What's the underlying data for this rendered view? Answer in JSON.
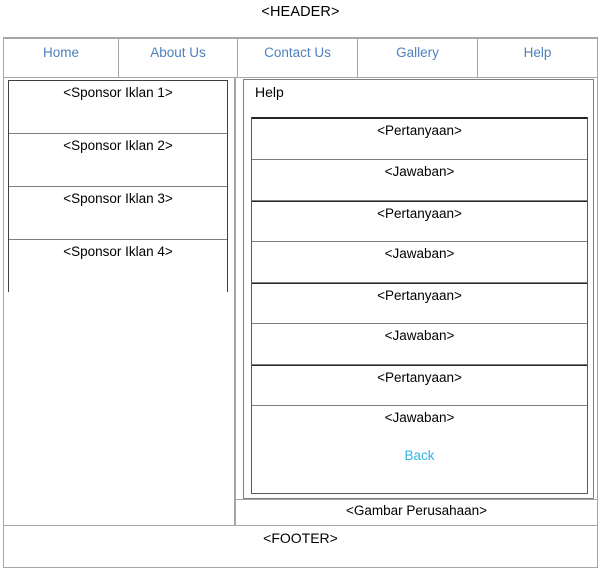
{
  "page": {
    "header_label": "<HEADER>",
    "footer_label": "<FOOTER>",
    "company_image_label": "<Gambar Perusahaan>"
  },
  "nav": {
    "link_color": "#4f81bd",
    "items": [
      {
        "label": "Home"
      },
      {
        "label": "About Us"
      },
      {
        "label": "Contact Us"
      },
      {
        "label": "Gallery"
      },
      {
        "label": "Help"
      }
    ]
  },
  "sidebar": {
    "sponsors": [
      {
        "label": "<Sponsor Iklan 1>"
      },
      {
        "label": "<Sponsor Iklan 2>"
      },
      {
        "label": "<Sponsor Iklan 3>"
      },
      {
        "label": "<Sponsor Iklan 4>"
      }
    ]
  },
  "main": {
    "panel_title": "Help",
    "back_label": "Back",
    "back_color": "#2fb6e8",
    "faq_rows": [
      {
        "label": "<Pertanyaan>",
        "kind": "question"
      },
      {
        "label": "<Jawaban>",
        "kind": "answer"
      },
      {
        "label": "<Pertanyaan>",
        "kind": "question"
      },
      {
        "label": "<Jawaban>",
        "kind": "answer"
      },
      {
        "label": "<Pertanyaan>",
        "kind": "question"
      },
      {
        "label": "<Jawaban>",
        "kind": "answer"
      },
      {
        "label": "<Pertanyaan>",
        "kind": "question"
      },
      {
        "label": "<Jawaban>",
        "kind": "answer"
      }
    ]
  }
}
